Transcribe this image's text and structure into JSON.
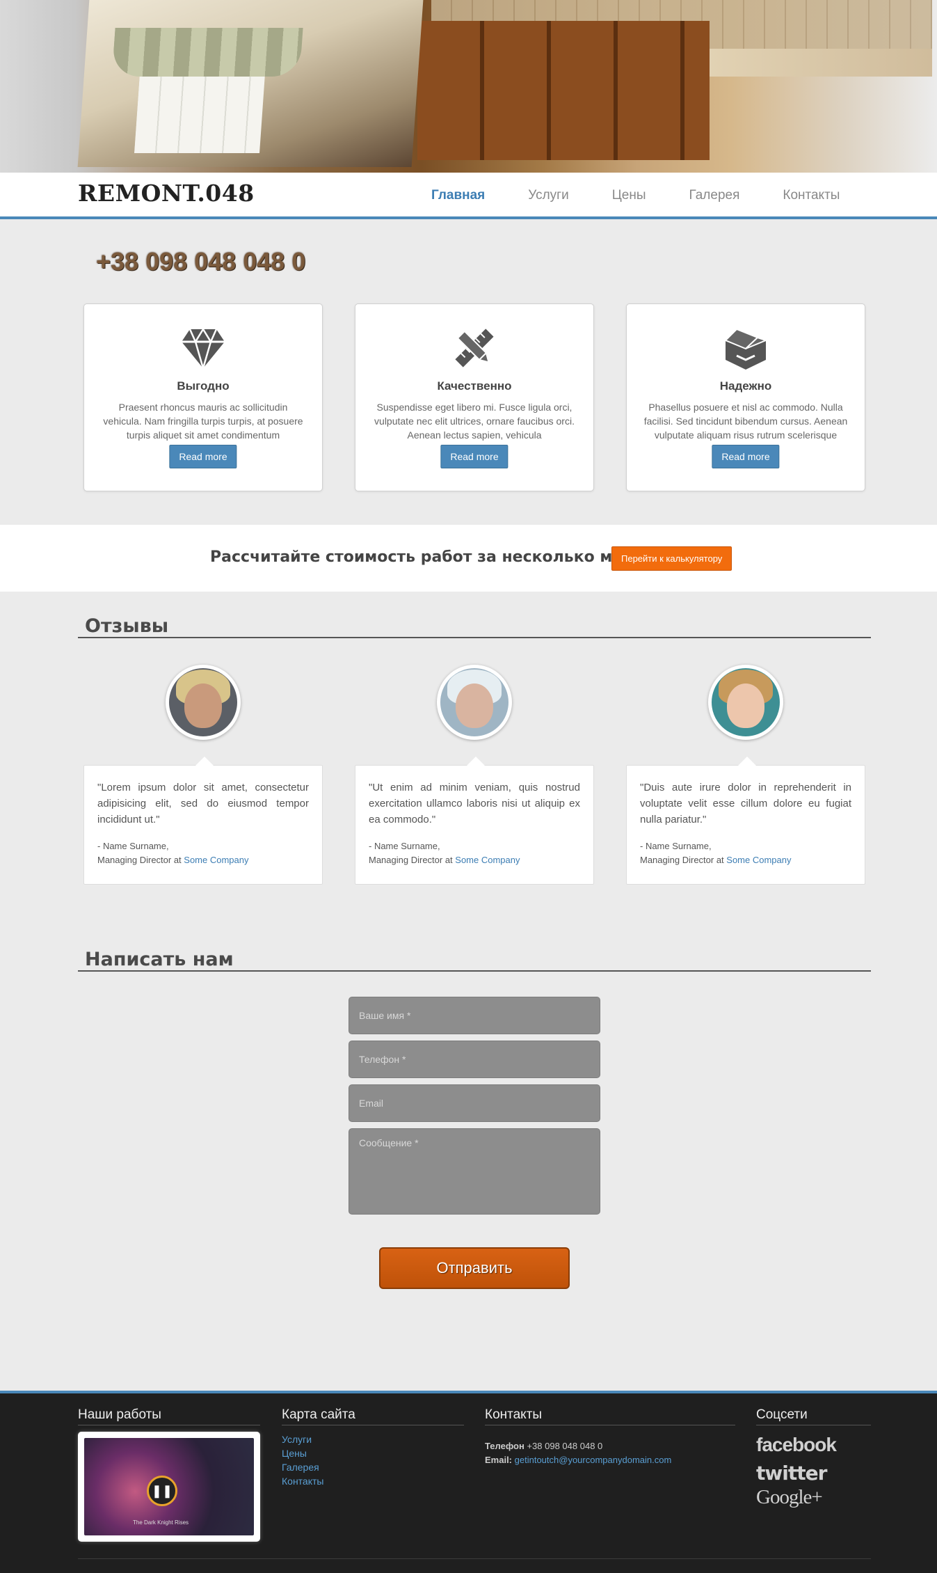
{
  "brand": {
    "logo": "REMONT.048",
    "accent": "#4a88b9",
    "orange": "#f26c0d"
  },
  "nav": [
    {
      "label": "Главная",
      "active": true
    },
    {
      "label": "Услуги"
    },
    {
      "label": "Цены"
    },
    {
      "label": "Галерея"
    },
    {
      "label": "Контакты"
    }
  ],
  "phone": "+38 098 048 048 0",
  "features": [
    {
      "icon": "diamond-icon",
      "title": "Выгодно",
      "text": "Praesent rhoncus mauris ac sollicitudin vehicula. Nam fringilla turpis turpis, at posuere turpis aliquet sit amet condimentum",
      "button": "Read more"
    },
    {
      "icon": "pencil-ruler-icon",
      "title": "Качественно",
      "text": "Suspendisse eget libero mi. Fusce ligula orci, vulputate nec elit ultrices, ornare faucibus orci. Aenean lectus sapien, vehicula",
      "button": "Read more"
    },
    {
      "icon": "box-icon",
      "title": "Надежно",
      "text": "Phasellus posuere et nisl ac commodo. Nulla facilisi. Sed tincidunt bibendum cursus. Aenean vulputate aliquam risus rutrum scelerisque",
      "button": "Read more"
    }
  ],
  "calc": {
    "text": "Рассчитайте стоимость работ за несколько минут!",
    "button": "Перейти к калькулятору"
  },
  "reviews_title": "Отзывы",
  "reviews": [
    {
      "quote": "\"Lorem ipsum dolor sit amet, consectetur adipisicing elit, sed do eiusmod tempor incididunt ut.\"",
      "name": "- Name Surname,",
      "role": "Managing Director at ",
      "company": "Some Company"
    },
    {
      "quote": "\"Ut enim ad minim veniam, quis nostrud exercitation ullamco laboris nisi ut aliquip ex ea commodo.\"",
      "name": "- Name Surname,",
      "role": "Managing Director at ",
      "company": "Some Company"
    },
    {
      "quote": "\"Duis aute irure dolor in reprehenderit in voluptate velit esse cillum dolore eu fugiat nulla pariatur.\"",
      "name": "- Name Surname,",
      "role": "Managing Director at ",
      "company": "Some Company"
    }
  ],
  "contact_title": "Написать нам",
  "form": {
    "name_placeholder": "Ваше имя *",
    "phone_placeholder": "Телефон *",
    "email_placeholder": "Email",
    "message_placeholder": "Сообщение *",
    "submit": "Отправить"
  },
  "footer": {
    "works_title": "Наши работы",
    "works_caption": "The Dark Knight Rises",
    "sitemap_title": "Карта сайта",
    "sitemap": [
      "Услуги",
      "Цены",
      "Галерея",
      "Контакты"
    ],
    "contacts_title": "Контакты",
    "phone_label": "Телефон",
    "phone": "+38 098 048 048 0",
    "email_label": "Email:",
    "email": "getintoutch@yourcompanydomain.com",
    "social_title": "Соцсети",
    "social": [
      "facebook",
      "twitter",
      "Google+"
    ]
  }
}
